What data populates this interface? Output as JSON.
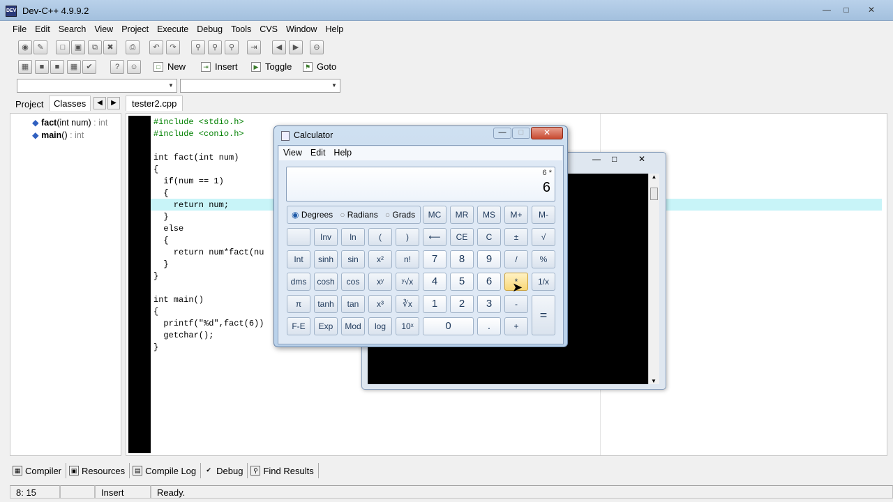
{
  "window": {
    "title": "Dev-C++ 4.9.9.2",
    "icon_text": "DEV"
  },
  "menu": [
    "File",
    "Edit",
    "Search",
    "View",
    "Project",
    "Execute",
    "Debug",
    "Tools",
    "CVS",
    "Window",
    "Help"
  ],
  "toolbar2": {
    "new_label": "New",
    "insert_label": "Insert",
    "toggle_label": "Toggle",
    "goto_label": "Goto"
  },
  "leftpanel": {
    "tabs": [
      "Project",
      "Classes"
    ],
    "items": [
      {
        "name": "fact",
        "params": "(int num)",
        "type": ": int"
      },
      {
        "name": "main",
        "params": "()",
        "type": ": int"
      }
    ]
  },
  "editor": {
    "file_tab": "tester2.cpp",
    "lines": [
      "#include <stdio.h>",
      "#include <conio.h>",
      "",
      "int fact(int num)",
      "{",
      "  if(num == 1)",
      "  {",
      "    return num;",
      "  }",
      "  else",
      "  {",
      "    return num*fact(nu",
      "  }",
      "}",
      "",
      "int main()",
      "{",
      "  printf(\"%d\",fact(6))",
      "  getchar();",
      "}"
    ]
  },
  "calculator": {
    "title": "Calculator",
    "menu": [
      "View",
      "Edit",
      "Help"
    ],
    "expression": "6 *",
    "value": "6",
    "angle_modes": [
      "Degrees",
      "Radians",
      "Grads"
    ],
    "selected_mode": "Degrees",
    "memory": [
      "MC",
      "MR",
      "MS",
      "M+",
      "M-"
    ],
    "rows": [
      [
        "",
        "Inv",
        "ln",
        "(",
        ")",
        "⟵",
        "CE",
        "C",
        "±",
        "√"
      ],
      [
        "Int",
        "sinh",
        "sin",
        "x²",
        "n!",
        "7",
        "8",
        "9",
        "/",
        "%"
      ],
      [
        "dms",
        "cosh",
        "cos",
        "xʸ",
        "ʸ√x",
        "4",
        "5",
        "6",
        "*",
        "1/x"
      ],
      [
        "π",
        "tanh",
        "tan",
        "x³",
        "∛x",
        "1",
        "2",
        "3",
        "-"
      ],
      [
        "F-E",
        "Exp",
        "Mod",
        "log",
        "10ˣ",
        "0",
        ".",
        "+"
      ]
    ],
    "equals": "="
  },
  "bottom_tabs": [
    "Compiler",
    "Resources",
    "Compile Log",
    "Debug",
    "Find Results"
  ],
  "status": {
    "position": "8: 15",
    "mode": "Insert",
    "message": "Ready."
  },
  "colors": {
    "highlight_line": "#c8f4f8",
    "gutter": "#000000",
    "directive": "#008000",
    "number": "#800080",
    "string": "#ff0000"
  }
}
